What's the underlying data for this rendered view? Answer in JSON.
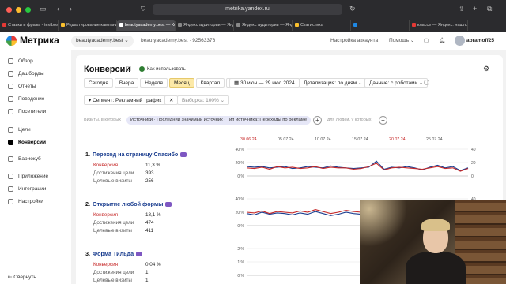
{
  "browser": {
    "url": "metrika.yandex.ru",
    "tabs": [
      {
        "label": "Ставки и фразы - textbosscou",
        "color": "#e53935"
      },
      {
        "label": "Редактирование кампаний",
        "color": "#fbc02d"
      },
      {
        "label": "beautyacademy.best — Конвер",
        "color": "#ffffff",
        "active": true
      },
      {
        "label": "Яндекс аудитории — Яндекс",
        "color": "#888888"
      },
      {
        "label": "Яндекс аудитории — Яндекс",
        "color": "#888888"
      },
      {
        "label": "Статистика",
        "color": "#fbc02d"
      },
      {
        "label": "",
        "color": "#1e88e5"
      },
      {
        "label": "классе — Яндекс: нашлось 4",
        "color": "#e53935"
      }
    ]
  },
  "header": {
    "logo": "Метрика",
    "site": "beautyacademy.best",
    "site_meta": "beautyacademy.best · 92563376",
    "account_settings": "Настройка аккаунта",
    "help": "Помощь",
    "notifications_count": "1",
    "username": "abramoff25"
  },
  "sidebar": {
    "items": [
      {
        "label": "Обзор"
      },
      {
        "label": "Дашборды"
      },
      {
        "label": "Отчеты"
      },
      {
        "label": "Поведение"
      },
      {
        "label": "Посетители"
      },
      {
        "label": "Цели"
      },
      {
        "label": "Конверсии",
        "active": true
      },
      {
        "label": "Вариокуб"
      },
      {
        "label": "Приложение"
      },
      {
        "label": "Интеграции"
      },
      {
        "label": "Настройки"
      }
    ],
    "collapse": "Свернуть"
  },
  "main": {
    "title": "Конверсии",
    "help_link": "Как использовать",
    "periods": [
      "Сегодня",
      "Вчера",
      "Неделя",
      "Месяц",
      "Квартал",
      "Год"
    ],
    "active_period": "Месяц",
    "date_range": "30 июн — 29 июл 2024",
    "detail": "Детализация: по дням",
    "data_source": "Данные: с роботами",
    "segment": "Сегмент: Рекламный трафик",
    "sample": "Выборка: 100%",
    "visits_in": "Визиты, в которых",
    "filter_pill": "Источники · Последний значимый источник · Тип источника: Переходы по рекламе",
    "people_in": "для людей, у которых"
  },
  "dates": [
    {
      "label": "30.06.24",
      "red": true
    },
    {
      "label": "05.07.24",
      "red": false
    },
    {
      "label": "10.07.24",
      "red": false
    },
    {
      "label": "15.07.24",
      "red": false
    },
    {
      "label": "20.07.24",
      "red": true
    },
    {
      "label": "25.07.24",
      "red": false
    }
  ],
  "goals": [
    {
      "num": "1.",
      "name": "Переход на страницу Спасибо",
      "conversion_label": "Конверсия",
      "conversion": "11,3 %",
      "reaches_label": "Достижения цели",
      "reaches": "393",
      "visits_label": "Целевые визиты",
      "visits": "256"
    },
    {
      "num": "2.",
      "name": "Открытие любой формы",
      "conversion_label": "Конверсия",
      "conversion": "18,1 %",
      "reaches_label": "Достижения цели",
      "reaches": "474",
      "visits_label": "Целевые визиты",
      "visits": "411"
    },
    {
      "num": "3.",
      "name": "Форма Тильда",
      "conversion_label": "Конверсия",
      "conversion": "0,04 %",
      "reaches_label": "Достижения цели",
      "reaches": "1",
      "visits_label": "Целевые визиты",
      "visits": "1"
    }
  ],
  "chart_data": [
    {
      "type": "line",
      "title": "Переход на страницу Спасибо",
      "x": [
        "30.06",
        "01.07",
        "02.07",
        "03.07",
        "04.07",
        "05.07",
        "06.07",
        "07.07",
        "08.07",
        "09.07",
        "10.07",
        "11.07",
        "12.07",
        "13.07",
        "14.07",
        "15.07",
        "16.07",
        "17.07",
        "18.07",
        "19.07",
        "20.07",
        "21.07",
        "22.07",
        "23.07",
        "24.07",
        "25.07",
        "26.07",
        "27.07",
        "28.07",
        "29.07"
      ],
      "left_axis_ticks": [
        "0 %",
        "20 %",
        "40 %"
      ],
      "right_axis_ticks": [
        "0",
        "20",
        "40"
      ],
      "left_ylim": [
        0,
        40
      ],
      "right_ylim": [
        0,
        40
      ],
      "series": [
        {
          "color": "#1a3d8f",
          "axis": "left",
          "values": [
            14,
            13,
            14,
            12,
            13,
            14,
            11,
            12,
            14,
            13,
            12,
            15,
            13,
            12,
            11,
            12,
            13,
            22,
            10,
            13,
            12,
            14,
            12,
            9,
            13,
            16,
            12,
            14,
            8,
            12
          ]
        },
        {
          "color": "#c62828",
          "axis": "right",
          "values": [
            12,
            11,
            13,
            10,
            14,
            12,
            13,
            11,
            12,
            14,
            11,
            13,
            12,
            12,
            10,
            11,
            14,
            19,
            9,
            12,
            13,
            12,
            11,
            10,
            12,
            14,
            11,
            12,
            7,
            11
          ]
        }
      ]
    },
    {
      "type": "line",
      "title": "Открытие любой формы",
      "x": [
        "30.06",
        "01.07",
        "02.07",
        "03.07",
        "04.07",
        "05.07",
        "06.07",
        "07.07",
        "08.07",
        "09.07",
        "10.07",
        "11.07",
        "12.07",
        "13.07",
        "14.07",
        "15.07",
        "16.07",
        "17.07",
        "18.07",
        "19.07",
        "20.07",
        "21.07",
        "22.07",
        "23.07",
        "24.07",
        "25.07",
        "26.07",
        "27.07",
        "28.07",
        "29.07"
      ],
      "left_axis_ticks": [
        "0 %",
        "20 %",
        "40 %"
      ],
      "right_axis_ticks": [
        "0",
        "20",
        "40"
      ],
      "left_ylim": [
        0,
        40
      ],
      "right_ylim": [
        0,
        40
      ],
      "series": [
        {
          "color": "#1a3d8f",
          "axis": "left",
          "values": [
            18,
            16,
            20,
            17,
            19,
            18,
            16,
            19,
            17,
            21,
            18,
            15,
            17,
            20,
            18,
            17,
            16,
            19,
            18,
            17,
            16,
            18,
            19,
            17,
            18,
            16,
            19,
            17,
            18,
            17
          ]
        },
        {
          "color": "#c62828",
          "axis": "right",
          "values": [
            20,
            19,
            22,
            18,
            21,
            20,
            19,
            22,
            20,
            24,
            21,
            18,
            20,
            23,
            21,
            20,
            19,
            22,
            30,
            20,
            19,
            21,
            22,
            20,
            21,
            19,
            22,
            20,
            21,
            20
          ]
        }
      ]
    },
    {
      "type": "line",
      "title": "Форма Тильда",
      "x": [
        "30.06",
        "01.07",
        "02.07",
        "03.07",
        "04.07",
        "05.07",
        "06.07",
        "07.07",
        "08.07",
        "09.07",
        "10.07",
        "11.07",
        "12.07",
        "13.07",
        "14.07",
        "15.07",
        "16.07",
        "17.07",
        "18.07",
        "19.07",
        "20.07",
        "21.07",
        "22.07",
        "23.07",
        "24.07",
        "25.07",
        "26.07",
        "27.07",
        "28.07",
        "29.07"
      ],
      "left_axis_ticks": [
        "0 %",
        "1 %",
        "2 %"
      ],
      "left_ylim": [
        0,
        2
      ],
      "series": []
    }
  ]
}
